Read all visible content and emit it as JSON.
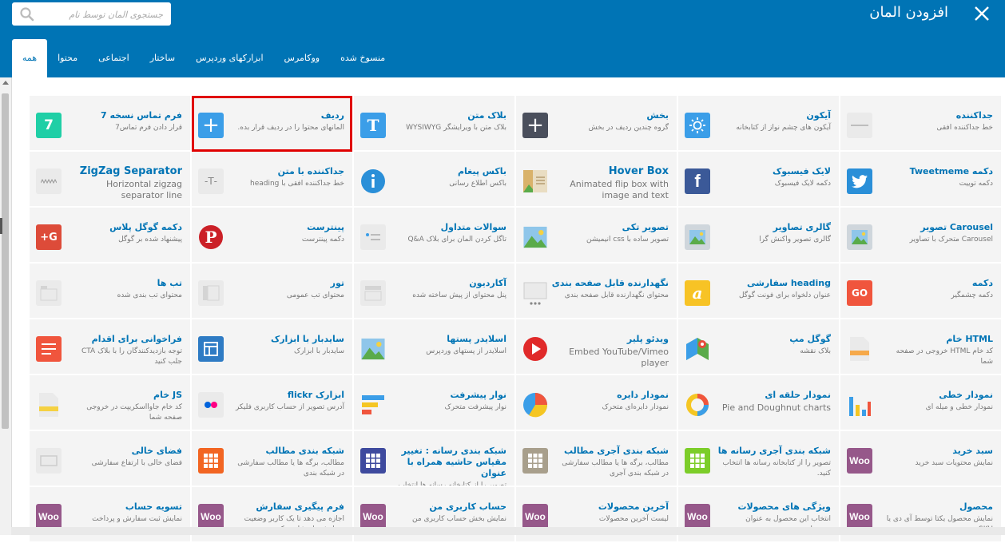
{
  "header": {
    "title": "افزودن المان",
    "close_icon": "close-icon",
    "search": {
      "placeholder": "جستجوی المان توسط نام",
      "value": ""
    }
  },
  "tabs": [
    {
      "label": "همه",
      "active": true
    },
    {
      "label": "محتوا"
    },
    {
      "label": "اجتماعی"
    },
    {
      "label": "ساختار"
    },
    {
      "label": "ابزارکهای وردپرس"
    },
    {
      "label": "ووکامرس"
    },
    {
      "label": "منسوخ شده"
    }
  ],
  "elements": [
    {
      "name": "جداکننده",
      "desc": "خط جداکننده افقی",
      "icon": "separator-icon"
    },
    {
      "name": "آیکون",
      "desc": "آیکون های چشم نواز از کتابخانه",
      "icon": "sun-icon"
    },
    {
      "name": "بخش",
      "desc": "گروه چندین ردیف در بخش",
      "icon": "plus-dark-icon"
    },
    {
      "name": "بلاک متن",
      "desc": "بلاک متن با ویرایشگر WYSIWYG",
      "icon": "text-block-icon"
    },
    {
      "name": "ردیف",
      "desc": "المانهای محتوا را در ردیف قرار بده.",
      "icon": "plus-icon",
      "highlight": true
    },
    {
      "name": "فرم تماس نسخه 7",
      "desc": "قرار دادن فرم تماس7",
      "icon": "contact-form-7-icon"
    },
    {
      "name": "دکمه Tweetmeme",
      "desc": "دکمه توییت",
      "icon": "twitter-icon"
    },
    {
      "name": "لایک فیسبوک",
      "desc": "دکمه لایک فیسبوک",
      "icon": "facebook-icon"
    },
    {
      "name": "Hover Box",
      "desc": "Animated flip box with image and text",
      "icon": "hover-box-icon"
    },
    {
      "name": "باکس پیغام",
      "desc": "باکس اطلاع رسانی",
      "icon": "info-icon"
    },
    {
      "name": "جداکننده با متن",
      "desc": "خط جداکننده افقی با heading",
      "icon": "text-separator-icon"
    },
    {
      "name": "ZigZag Separator",
      "desc": "Horizontal zigzag separator line",
      "icon": "zigzag-icon"
    },
    {
      "name": "Carousel تصویر",
      "desc": "Carousel متحرک با تصاویر",
      "icon": "carousel-icon"
    },
    {
      "name": "گالری تصاویر",
      "desc": "گالری تصویر واکنش گرا",
      "icon": "gallery-icon"
    },
    {
      "name": "تصویر تکی",
      "desc": "تصویر ساده با css انیمیشن",
      "icon": "image-icon"
    },
    {
      "name": "سوالات متداول",
      "desc": "تاگل کردن المان برای بلاک Q&A",
      "icon": "faq-icon"
    },
    {
      "name": "پینترست",
      "desc": "دکمه پینترست",
      "icon": "pinterest-icon"
    },
    {
      "name": "دکمه گوگل پلاس",
      "desc": "پیشنهاد شده بر گوگل",
      "icon": "google-plus-icon"
    },
    {
      "name": "دکمه",
      "desc": "دکمه چشمگیر",
      "icon": "go-button-icon"
    },
    {
      "name": "heading سفارشی",
      "desc": "عنوان دلخواه برای فونت گوگل",
      "icon": "custom-heading-icon"
    },
    {
      "name": "نگهدارنده قابل صفحه بندی",
      "desc": "محتوای نگهدارنده قابل صفحه بندی",
      "icon": "pageable-icon"
    },
    {
      "name": "آکاردیون",
      "desc": "پنل محتوای از پیش ساخته شده",
      "icon": "accordion-icon"
    },
    {
      "name": "تور",
      "desc": "محتوای تب عمومی",
      "icon": "tour-icon"
    },
    {
      "name": "تب ها",
      "desc": "محتوای تب بندی شده",
      "icon": "tabs-icon"
    },
    {
      "name": "HTML خام",
      "desc": "کد خام HTML خروجی در صفحه شما",
      "icon": "html-icon"
    },
    {
      "name": "گوگل مپ",
      "desc": "بلاک نقشه",
      "icon": "map-icon"
    },
    {
      "name": "ویدئو پلیر",
      "desc": "Embed YouTube/Vimeo player",
      "icon": "video-icon"
    },
    {
      "name": "اسلایدر پستها",
      "desc": "اسلایدر از پستهای وردپرس",
      "icon": "post-slider-icon"
    },
    {
      "name": "سایدبار با ابزارک",
      "desc": "سایدبار با ابزارک",
      "icon": "sidebar-icon"
    },
    {
      "name": "فراخوانی برای اقدام",
      "desc": "توجه بازدیدکنندگان را با بلاک CTA جلب کنید",
      "icon": "cta-icon"
    },
    {
      "name": "نمودار خطی",
      "desc": "نمودار خطی و میله ای",
      "icon": "bar-chart-icon"
    },
    {
      "name": "نمودار حلقه ای",
      "desc": "Pie and Doughnut charts",
      "icon": "donut-chart-icon"
    },
    {
      "name": "نمودار دایره",
      "desc": "نمودار دایره‌ای متحرک",
      "icon": "pie-chart-icon"
    },
    {
      "name": "نوار پیشرفت",
      "desc": "نوار پیشرفت متحرک",
      "icon": "progress-bar-icon"
    },
    {
      "name": "ابزارک flickr",
      "desc": "آدرس تصویر از حساب کاربری فلیکر",
      "icon": "flickr-icon"
    },
    {
      "name": "JS خام",
      "desc": "کد خام جاوااسکریپت در خروجی صفحه شما",
      "icon": "js-icon"
    },
    {
      "name": "سبد خرید",
      "desc": "نمایش محتویات سبد خرید",
      "icon": "woo-icon"
    },
    {
      "name": "شبکه بندی آجری رسانه ها",
      "desc": "تصویر را از کتابخانه رسانه ها انتخاب کنید.",
      "icon": "masonry-media-grid-icon"
    },
    {
      "name": "شبکه بندی آجری مطالب",
      "desc": "مطالب، برگه ها یا مطالب سفارشی در شبکه بندی آجری",
      "icon": "masonry-grid-icon"
    },
    {
      "name": "شبکه بندی رسانه : تغییر مقیاس حاشیه همراه با عنوان",
      "desc": "تصویر را از کتابخانه رسانه ها انتخاب کنید.",
      "icon": "media-grid-icon"
    },
    {
      "name": "شبکه بندی مطالب",
      "desc": "مطالب، برگه ها یا مطالب سفارشی در شبکه بندی",
      "icon": "post-grid-icon"
    },
    {
      "name": "فضای خالی",
      "desc": "فضای خالی با ارتفاع سفارشی",
      "icon": "empty-space-icon"
    },
    {
      "name": "محصول",
      "desc": "نمایش محصول یکتا توسط آی دی یا SKU",
      "icon": "woo-icon"
    },
    {
      "name": "ویژگی های محصولات",
      "desc": "انتخاب این محصول به عنوان محصول ویژه",
      "icon": "woo-icon"
    },
    {
      "name": "آخرین محصولات",
      "desc": "لیست آخرین محصولات",
      "icon": "woo-icon"
    },
    {
      "name": "حساب کاربری من",
      "desc": "نمایش بخش حساب کاربری من",
      "icon": "woo-icon"
    },
    {
      "name": "فرم پیگیری سفارش",
      "desc": "اجازه می دهد تا یک کاربر وضعیت سفارش را مشاهده کند",
      "icon": "woo-icon"
    },
    {
      "name": "تسویه حساب",
      "desc": "نمایش ثبت سفارش و پرداخت",
      "icon": "woo-icon"
    }
  ],
  "colors": {
    "header": "#0074b5",
    "tile": "#f4f4f4",
    "element_name": "#0074b5",
    "highlight_border": "#e00000"
  }
}
